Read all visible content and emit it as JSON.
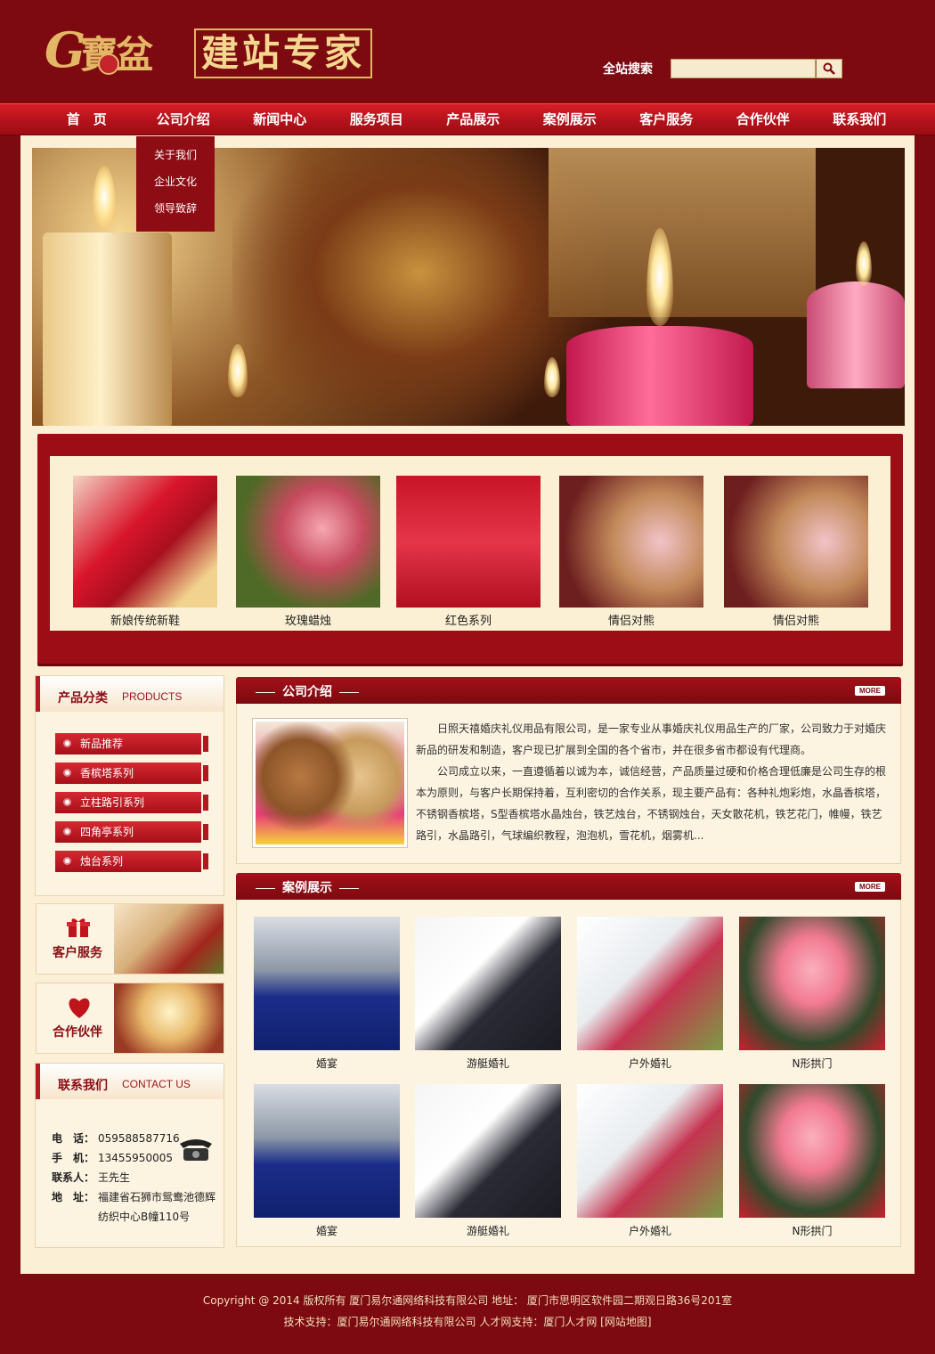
{
  "header": {
    "logo_script": "寶盆",
    "logo_letter": "G",
    "logo_text": "建站专家",
    "search_label": "全站搜索",
    "search_placeholder": ""
  },
  "nav": {
    "items": [
      "首　页",
      "公司介绍",
      "新闻中心",
      "服务项目",
      "产品展示",
      "案例展示",
      "客户服务",
      "合作伙伴",
      "联系我们"
    ],
    "dropdown": [
      "关于我们",
      "企业文化",
      "领导致辞"
    ]
  },
  "showcase": {
    "items": [
      {
        "caption": "新娘传统新鞋"
      },
      {
        "caption": "玫瑰蜡烛"
      },
      {
        "caption": "红色系列"
      },
      {
        "caption": "情侣对熊"
      },
      {
        "caption": "情侣对熊"
      }
    ]
  },
  "sidebar": {
    "products_title": "产品分类",
    "products_title_en": "PRODUCTS",
    "categories": [
      "新品推荐",
      "香槟塔系列",
      "立柱路引系列",
      "四角亭系列",
      "烛台系列"
    ],
    "customer_service": "客户服务",
    "partners": "合作伙伴",
    "contact_title": "联系我们",
    "contact_title_en": "CONTACT US",
    "contact": {
      "phone_label": "电　话：",
      "phone": "059588587716",
      "mobile_label": "手　机：",
      "mobile": "13455950005",
      "person_label": "联系人：",
      "person": "王先生",
      "address_label": "地　址：",
      "address_1": "福建省石狮市鸳鸯池德辉",
      "address_2": "纺织中心B幢110号"
    }
  },
  "about": {
    "title": "公司介绍",
    "more": "MORE",
    "para1": "日照天禧婚庆礼仪用品有限公司，是一家专业从事婚庆礼仪用品生产的厂家，公司致力于对婚庆新品的研发和制造，客户现已扩展到全国的各个省市，并在很多省市都设有代理商。",
    "para2": "公司成立以来，一直遵循着以诚为本，诚信经营，产品质量过硬和价格合理低廉是公司生存的根本为原则，与客户长期保持着，互利密切的合作关系，现主要产品有：各种礼炮彩炮，水晶香槟塔，不锈钢香槟塔，S型香槟塔水晶烛台，铁艺烛台，不锈钢烛台，天女散花机，铁艺花门，帷幔，铁艺路引，水晶路引，气球编织教程，泡泡机，雪花机，烟雾机..."
  },
  "cases": {
    "title": "案例展示",
    "more": "MORE",
    "items": [
      "婚宴",
      "游艇婚礼",
      "户外婚礼",
      "N形拱门",
      "婚宴",
      "游艇婚礼",
      "户外婚礼",
      "N形拱门"
    ]
  },
  "footer": {
    "line1": "Copyright @ 2014 版权所有 厦门易尔通网络科技有限公司 地址： 厦门市思明区软件园二期观日路36号201室",
    "line2": "技术支持：厦门易尔通网络科技有限公司 人才网支持：厦门人才网 [网站地图]"
  },
  "colors": {
    "brand": "#7c0a10",
    "nav": "#c0141d",
    "cream": "#fbefd6",
    "gold": "#e3b765"
  }
}
